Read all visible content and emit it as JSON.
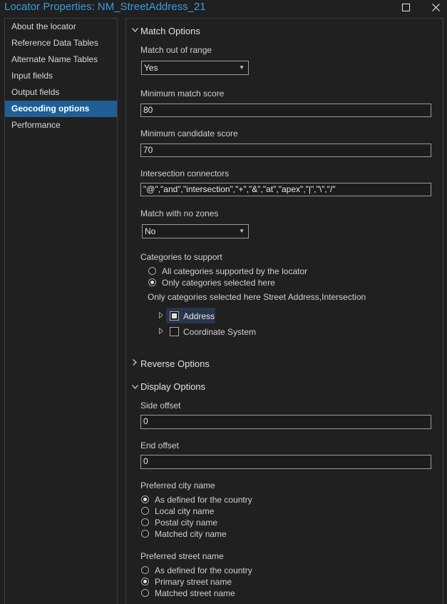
{
  "window": {
    "title": "Locator Properties: NM_StreetAddress_21",
    "minimize_glyph": "—",
    "maximize_glyph": "☐",
    "close_glyph": "✕"
  },
  "sidebar": {
    "items": [
      {
        "label": "About the locator",
        "active": false
      },
      {
        "label": "Reference Data Tables",
        "active": false
      },
      {
        "label": "Alternate Name Tables",
        "active": false
      },
      {
        "label": "Input fields",
        "active": false
      },
      {
        "label": "Output fields",
        "active": false
      },
      {
        "label": "Geocoding options",
        "active": true
      },
      {
        "label": "Performance",
        "active": false
      }
    ]
  },
  "match_options": {
    "header": "Match Options",
    "match_out_of_range": {
      "label": "Match out of range",
      "value": "Yes"
    },
    "min_match_score": {
      "label": "Minimum match score",
      "value": "80"
    },
    "min_candidate_score": {
      "label": "Minimum candidate score",
      "value": "70"
    },
    "intersection_connectors": {
      "label": "Intersection connectors",
      "value": "\"@\",\"and\",\"intersection\",\"+\",\"&\",\"at\",\"apex\",\"|\",\"\\\",\"/\""
    },
    "match_no_zones": {
      "label": "Match with no zones",
      "value": "No"
    },
    "categories": {
      "label": "Categories to support",
      "options": [
        {
          "label": "All categories supported by the locator",
          "checked": false
        },
        {
          "label": "Only categories selected here",
          "checked": true
        }
      ],
      "summary": "Only categories selected here Street Address,Intersection",
      "tree": [
        {
          "label": "Address",
          "state": "partial",
          "highlighted": true
        },
        {
          "label": "Coordinate System",
          "state": "unchecked",
          "highlighted": false
        }
      ]
    }
  },
  "reverse_options": {
    "header": "Reverse Options"
  },
  "display_options": {
    "header": "Display Options",
    "side_offset": {
      "label": "Side offset",
      "value": "0"
    },
    "end_offset": {
      "label": "End offset",
      "value": "0"
    },
    "preferred_city": {
      "label": "Preferred city name",
      "options": [
        {
          "label": "As defined for the country",
          "checked": true
        },
        {
          "label": "Local city name",
          "checked": false
        },
        {
          "label": "Postal city name",
          "checked": false
        },
        {
          "label": "Matched city name",
          "checked": false
        }
      ]
    },
    "preferred_street": {
      "label": "Preferred street name",
      "options": [
        {
          "label": "As defined for the country",
          "checked": false
        },
        {
          "label": "Primary street name",
          "checked": true
        },
        {
          "label": "Matched street name",
          "checked": false
        }
      ]
    }
  },
  "colors": {
    "accent": "#1f5f97",
    "title_text": "#3b9ddd",
    "background": "#202020"
  }
}
